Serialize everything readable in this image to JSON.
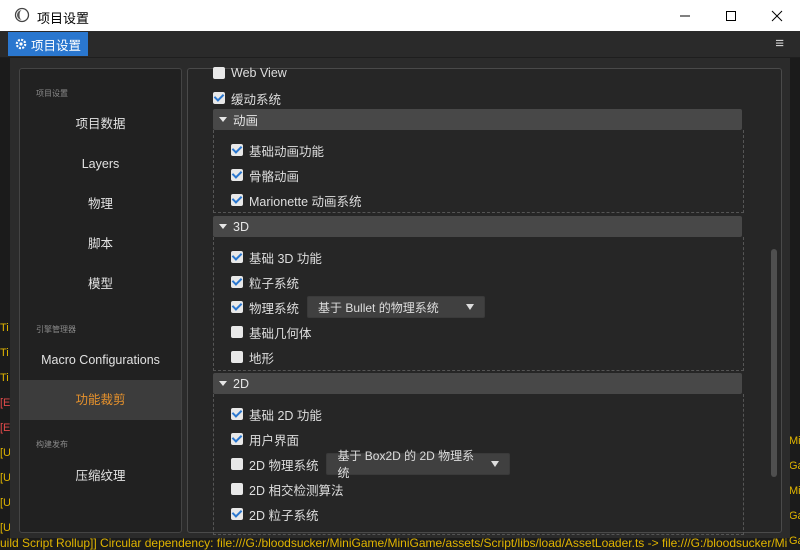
{
  "window": {
    "title": "项目设置"
  },
  "tab": {
    "label": "项目设置"
  },
  "sidebar": {
    "sections": [
      {
        "title": "项目设置",
        "items": [
          "项目数据",
          "Layers",
          "物理",
          "脚本",
          "模型"
        ]
      },
      {
        "title": "引擎管理器",
        "items": [
          "Macro Configurations",
          "功能裁剪"
        ]
      },
      {
        "title": "构建发布",
        "items": [
          "压缩纹理"
        ]
      }
    ]
  },
  "content": {
    "top": [
      {
        "label": "Web View",
        "checked": false
      },
      {
        "label": "缓动系统",
        "checked": true
      }
    ],
    "groups": [
      {
        "title": "动画",
        "items": [
          {
            "label": "基础动画功能",
            "checked": true
          },
          {
            "label": "骨骼动画",
            "checked": true
          },
          {
            "label": "Marionette 动画系统",
            "checked": true
          }
        ]
      },
      {
        "title": "3D",
        "items": [
          {
            "label": "基础 3D 功能",
            "checked": true
          },
          {
            "label": "粒子系统",
            "checked": true
          },
          {
            "label": "物理系统",
            "checked": true,
            "select": "基于 Bullet 的物理系统"
          },
          {
            "label": "基础几何体",
            "checked": false
          },
          {
            "label": "地形",
            "checked": false
          }
        ]
      },
      {
        "title": "2D",
        "items": [
          {
            "label": "基础 2D 功能",
            "checked": true
          },
          {
            "label": "用户界面",
            "checked": true
          },
          {
            "label": "2D 物理系统",
            "checked": false,
            "select": "基于 Box2D 的 2D 物理系统"
          },
          {
            "label": "2D 相交检测算法",
            "checked": false
          },
          {
            "label": "2D 粒子系统",
            "checked": true
          }
        ]
      }
    ]
  },
  "background": {
    "console_line": "uild Script Rollup]] Circular dependency: file:///G:/bloodsucker/MiniGame/MiniGame/assets/Script/libs/load/AssetLoader.ts -> file:///G:/bloodsucker/Mi",
    "left_fragments": [
      "Ti",
      "Ti",
      "Ti",
      "[E",
      "[E",
      "[U",
      "[U",
      "[U",
      "[U"
    ],
    "right_fragments": [
      "Mi",
      "Ga",
      "Mi",
      "Ga",
      "Ga"
    ],
    "colors": {
      "warn": "#e0b400",
      "error": "#e04a4a",
      "text": "#cfcfcf"
    }
  }
}
